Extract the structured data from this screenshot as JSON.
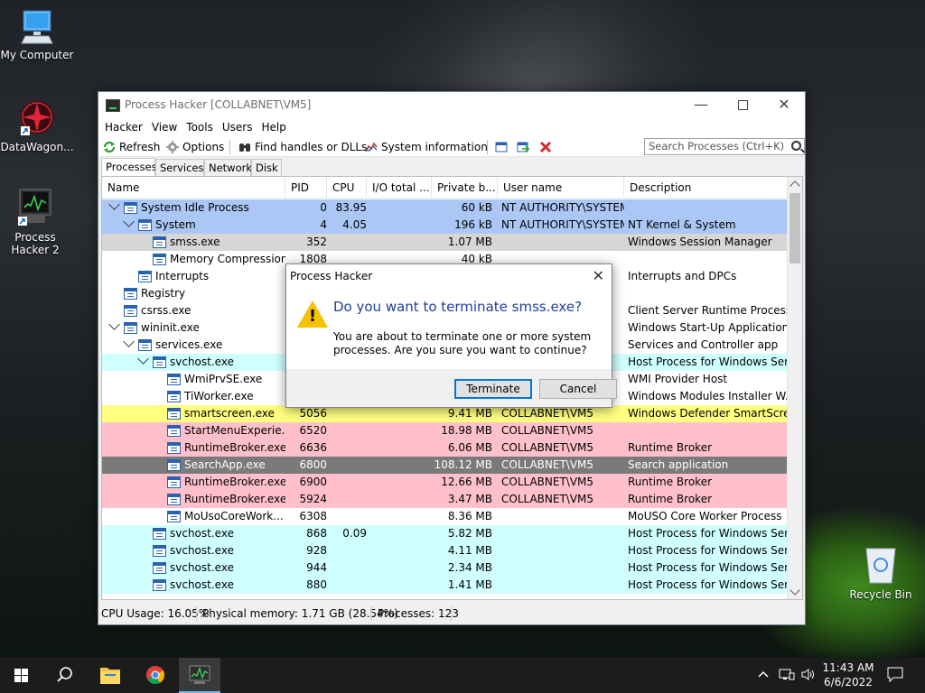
{
  "desktop": {
    "icons": [
      {
        "label": "My Computer"
      },
      {
        "label": "DataWagon..."
      },
      {
        "label": "Process Hacker 2"
      },
      {
        "label": "Recycle Bin"
      }
    ]
  },
  "window": {
    "title": "Process Hacker [COLLABNET\\VM5]",
    "menu": [
      "Hacker",
      "View",
      "Tools",
      "Users",
      "Help"
    ],
    "toolbar": {
      "refresh": "Refresh",
      "options": "Options",
      "find_handles": "Find handles or DLLs",
      "system_info": "System information"
    },
    "search_placeholder": "Search Processes (Ctrl+K)",
    "tabs": [
      "Processes",
      "Services",
      "Network",
      "Disk"
    ],
    "columns": {
      "name": "Name",
      "pid": "PID",
      "cpu": "CPU",
      "io": "I/O total ...",
      "private": "Private b...",
      "user": "User name",
      "desc": "Description"
    },
    "rows": [
      {
        "name": "System Idle Process",
        "pid": "0",
        "cpu": "83.95",
        "priv": "60 kB",
        "user": "NT AUTHORITY\\SYSTEM",
        "desc": ""
      },
      {
        "name": "System",
        "pid": "4",
        "cpu": "4.05",
        "priv": "196 kB",
        "user": "NT AUTHORITY\\SYSTEM",
        "desc": "NT Kernel & System"
      },
      {
        "name": "smss.exe",
        "pid": "352",
        "cpu": "",
        "priv": "1.07 MB",
        "user": "",
        "desc": "Windows Session Manager"
      },
      {
        "name": "Memory Compression",
        "pid": "1808",
        "cpu": "",
        "priv": "40 kB",
        "user": "",
        "desc": ""
      },
      {
        "name": "Interrupts",
        "pid": "",
        "cpu": "",
        "priv": "",
        "user": "",
        "desc": "Interrupts and DPCs"
      },
      {
        "name": "Registry",
        "pid": "",
        "cpu": "",
        "priv": "",
        "user": "",
        "desc": ""
      },
      {
        "name": "csrss.exe",
        "pid": "",
        "cpu": "",
        "priv": "",
        "user": "",
        "desc": "Client Server Runtime Process"
      },
      {
        "name": "wininit.exe",
        "pid": "",
        "cpu": "",
        "priv": "",
        "user": "",
        "desc": "Windows Start-Up Application"
      },
      {
        "name": "services.exe",
        "pid": "",
        "cpu": "",
        "priv": "",
        "user": "",
        "desc": "Services and Controller app"
      },
      {
        "name": "svchost.exe",
        "pid": "",
        "cpu": "",
        "priv": "",
        "user": "",
        "desc": "Host Process for Windows Ser..."
      },
      {
        "name": "WmiPrvSE.exe",
        "pid": "",
        "cpu": "",
        "priv": "",
        "user": "",
        "desc": "WMI Provider Host"
      },
      {
        "name": "TiWorker.exe",
        "pid": "",
        "cpu": "",
        "priv": "",
        "user": "",
        "desc": "Windows Modules Installer W..."
      },
      {
        "name": "smartscreen.exe",
        "pid": "5056",
        "cpu": "",
        "priv": "9.41 MB",
        "user": "COLLABNET\\VM5",
        "desc": "Windows Defender SmartScre..."
      },
      {
        "name": "StartMenuExperie...",
        "pid": "6520",
        "cpu": "",
        "priv": "18.98 MB",
        "user": "COLLABNET\\VM5",
        "desc": ""
      },
      {
        "name": "RuntimeBroker.exe",
        "pid": "6636",
        "cpu": "",
        "priv": "6.06 MB",
        "user": "COLLABNET\\VM5",
        "desc": "Runtime Broker"
      },
      {
        "name": "SearchApp.exe",
        "pid": "6800",
        "cpu": "",
        "priv": "108.12 MB",
        "user": "COLLABNET\\VM5",
        "desc": "Search application"
      },
      {
        "name": "RuntimeBroker.exe",
        "pid": "6900",
        "cpu": "",
        "priv": "12.66 MB",
        "user": "COLLABNET\\VM5",
        "desc": "Runtime Broker"
      },
      {
        "name": "RuntimeBroker.exe",
        "pid": "5924",
        "cpu": "",
        "priv": "3.47 MB",
        "user": "COLLABNET\\VM5",
        "desc": "Runtime Broker"
      },
      {
        "name": "MoUsoCoreWork...",
        "pid": "6308",
        "cpu": "",
        "priv": "8.36 MB",
        "user": "",
        "desc": "MoUSO Core Worker Process"
      },
      {
        "name": "svchost.exe",
        "pid": "868",
        "cpu": "0.09",
        "priv": "5.82 MB",
        "user": "",
        "desc": "Host Process for Windows Ser..."
      },
      {
        "name": "svchost.exe",
        "pid": "928",
        "cpu": "",
        "priv": "4.11 MB",
        "user": "",
        "desc": "Host Process for Windows Ser..."
      },
      {
        "name": "svchost.exe",
        "pid": "944",
        "cpu": "",
        "priv": "2.34 MB",
        "user": "",
        "desc": "Host Process for Windows Ser..."
      },
      {
        "name": "svchost.exe",
        "pid": "880",
        "cpu": "",
        "priv": "1.41 MB",
        "user": "",
        "desc": "Host Process for Windows Ser..."
      }
    ],
    "status": {
      "cpu": "CPU Usage: 16.05%",
      "memory": "Physical memory: 1.71 GB (28.54%)",
      "processes": "Processes: 123"
    }
  },
  "dialog": {
    "title": "Process Hacker",
    "main": "Do you want to terminate smss.exe?",
    "sub": "You are about to terminate one or more system processes. Are you sure you want to continue?",
    "terminate": "Terminate",
    "cancel": "Cancel"
  },
  "taskbar": {
    "time": "11:43 AM",
    "date": "6/6/2022"
  },
  "colors": {
    "selected": "#aac7f5",
    "gray_selected": "#d6d6d6",
    "system": "#aac7f5",
    "service": "#d0ffff",
    "own": "#ffff80",
    "pink": "#ffc0cb",
    "dark": "#7a7a7a"
  }
}
